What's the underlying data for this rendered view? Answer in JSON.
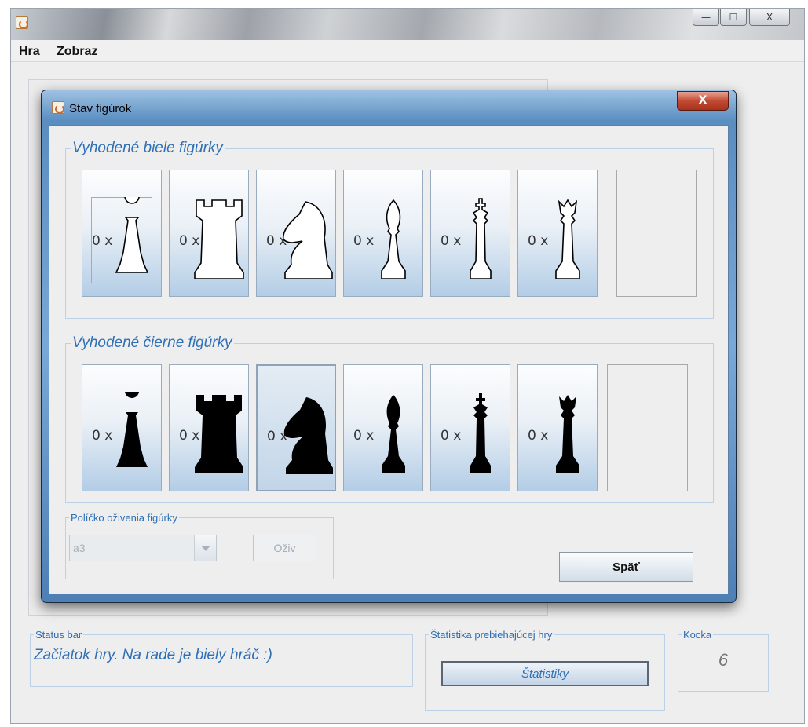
{
  "main_window": {
    "menu": [
      "Hra",
      "Zobraz"
    ],
    "controls": {
      "minimize": "—",
      "maximize": "☐",
      "close": "X"
    }
  },
  "status_bar": {
    "legend": "Status bar",
    "text": "Začiatok hry. Na rade je biely hráč :)"
  },
  "stats": {
    "legend": "Štatistika prebiehajúcej hry",
    "button_label": "Štatistiky"
  },
  "dice": {
    "legend": "Kocka",
    "value": "6"
  },
  "dialog": {
    "title": "Stav figúrok",
    "close_label": "X",
    "white_group": {
      "legend": "Vyhodené biele figúrky",
      "pieces": [
        {
          "name": "pawn",
          "count": "0 x"
        },
        {
          "name": "rook",
          "count": "0 x"
        },
        {
          "name": "knight",
          "count": "0 x"
        },
        {
          "name": "bishop",
          "count": "0 x"
        },
        {
          "name": "king",
          "count": "0 x"
        },
        {
          "name": "queen",
          "count": "0 x"
        }
      ]
    },
    "black_group": {
      "legend": "Vyhodené čierne figúrky",
      "pieces": [
        {
          "name": "pawn",
          "count": "0 x"
        },
        {
          "name": "rook",
          "count": "0 x"
        },
        {
          "name": "knight",
          "count": "0 x"
        },
        {
          "name": "bishop",
          "count": "0 x"
        },
        {
          "name": "king",
          "count": "0 x"
        },
        {
          "name": "queen",
          "count": "0 x"
        }
      ]
    },
    "revive": {
      "legend": "Políčko oživenia figúrky",
      "square": "a3",
      "button_label": "Oživ"
    },
    "back_label": "Späť"
  },
  "colors": {
    "accent": "#2e6fb5",
    "white_piece": "#ffffff",
    "black_piece": "#000000",
    "dialog_frame": "#5a8dc0"
  }
}
